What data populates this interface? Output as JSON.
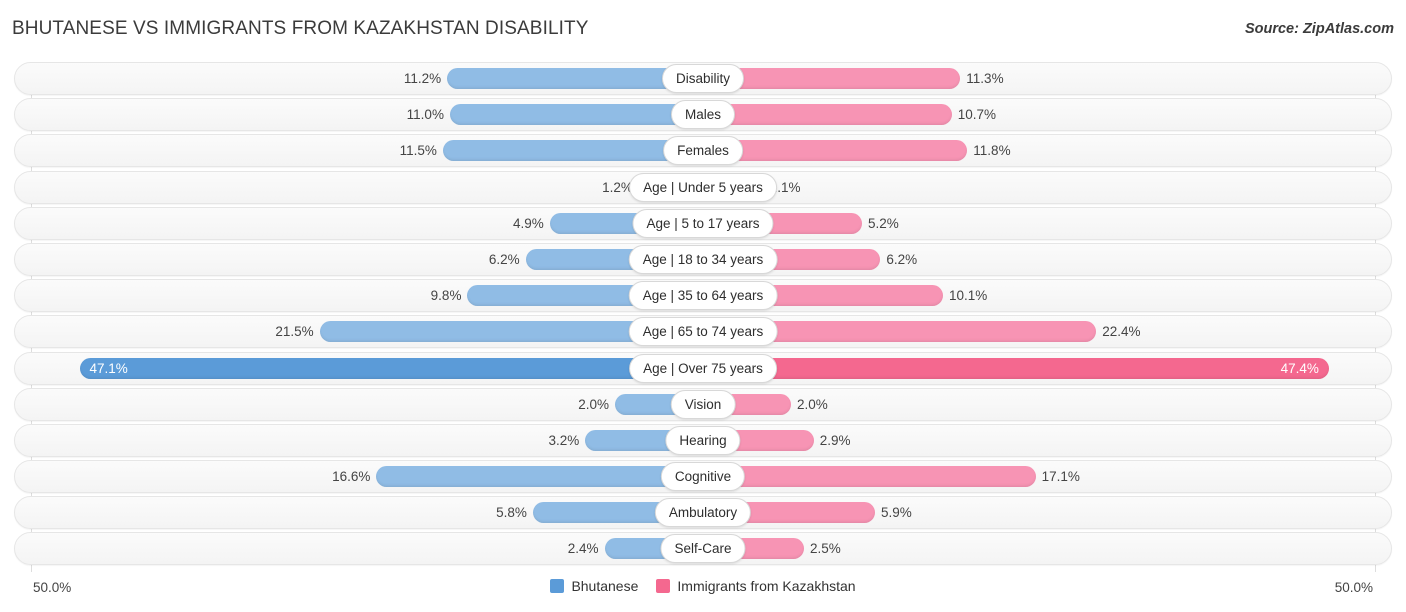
{
  "header": {
    "title": "BHUTANESE VS IMMIGRANTS FROM KAZAKHSTAN DISABILITY",
    "source": "Source: ZipAtlas.com"
  },
  "axis": {
    "left_label": "50.0%",
    "right_label": "50.0%",
    "max": 50.0
  },
  "legend": {
    "items": [
      {
        "label": "Bhutanese",
        "color": "#5b9bd8"
      },
      {
        "label": "Immigrants from Kazakhstan",
        "color": "#f4688f"
      }
    ]
  },
  "colors": {
    "left_bar": "#90bce5",
    "right_bar": "#f794b4",
    "left_bar_highlight": "#5b9bd8",
    "right_bar_highlight": "#f4688f",
    "track": "#f6f6f6",
    "gridline": "#dddddd"
  },
  "chart_data": {
    "type": "bar",
    "title": "BHUTANESE VS IMMIGRANTS FROM KAZAKHSTAN DISABILITY",
    "subtitle": "Source: ZipAtlas.com",
    "orientation": "horizontal-diverging",
    "xlabel": "",
    "ylabel": "",
    "xlim": [
      -50.0,
      50.0
    ],
    "grid": false,
    "legend_position": "bottom-center",
    "categories": [
      "Disability",
      "Males",
      "Females",
      "Age | Under 5 years",
      "Age | 5 to 17 years",
      "Age | 18 to 34 years",
      "Age | 35 to 64 years",
      "Age | 65 to 74 years",
      "Age | Over 75 years",
      "Vision",
      "Hearing",
      "Cognitive",
      "Ambulatory",
      "Self-Care"
    ],
    "series": [
      {
        "name": "Bhutanese",
        "color": "#5b9bd8",
        "values": [
          11.2,
          11.0,
          11.5,
          1.2,
          4.9,
          6.2,
          9.8,
          21.5,
          47.1,
          2.0,
          3.2,
          16.6,
          5.8,
          2.4
        ],
        "labels": [
          "11.2%",
          "11.0%",
          "11.5%",
          "1.2%",
          "4.9%",
          "6.2%",
          "9.8%",
          "21.5%",
          "47.1%",
          "2.0%",
          "3.2%",
          "16.6%",
          "5.8%",
          "2.4%"
        ]
      },
      {
        "name": "Immigrants from Kazakhstan",
        "color": "#f4688f",
        "values": [
          11.3,
          10.7,
          11.8,
          1.1,
          5.2,
          6.2,
          10.1,
          22.4,
          47.4,
          2.0,
          2.9,
          17.1,
          5.9,
          2.5
        ],
        "labels": [
          "11.3%",
          "10.7%",
          "11.8%",
          "1.1%",
          "5.2%",
          "6.2%",
          "10.1%",
          "22.4%",
          "47.4%",
          "2.0%",
          "2.9%",
          "17.1%",
          "5.9%",
          "2.5%"
        ]
      }
    ],
    "highlighted_categories": [
      "Age | Over 75 years"
    ]
  }
}
